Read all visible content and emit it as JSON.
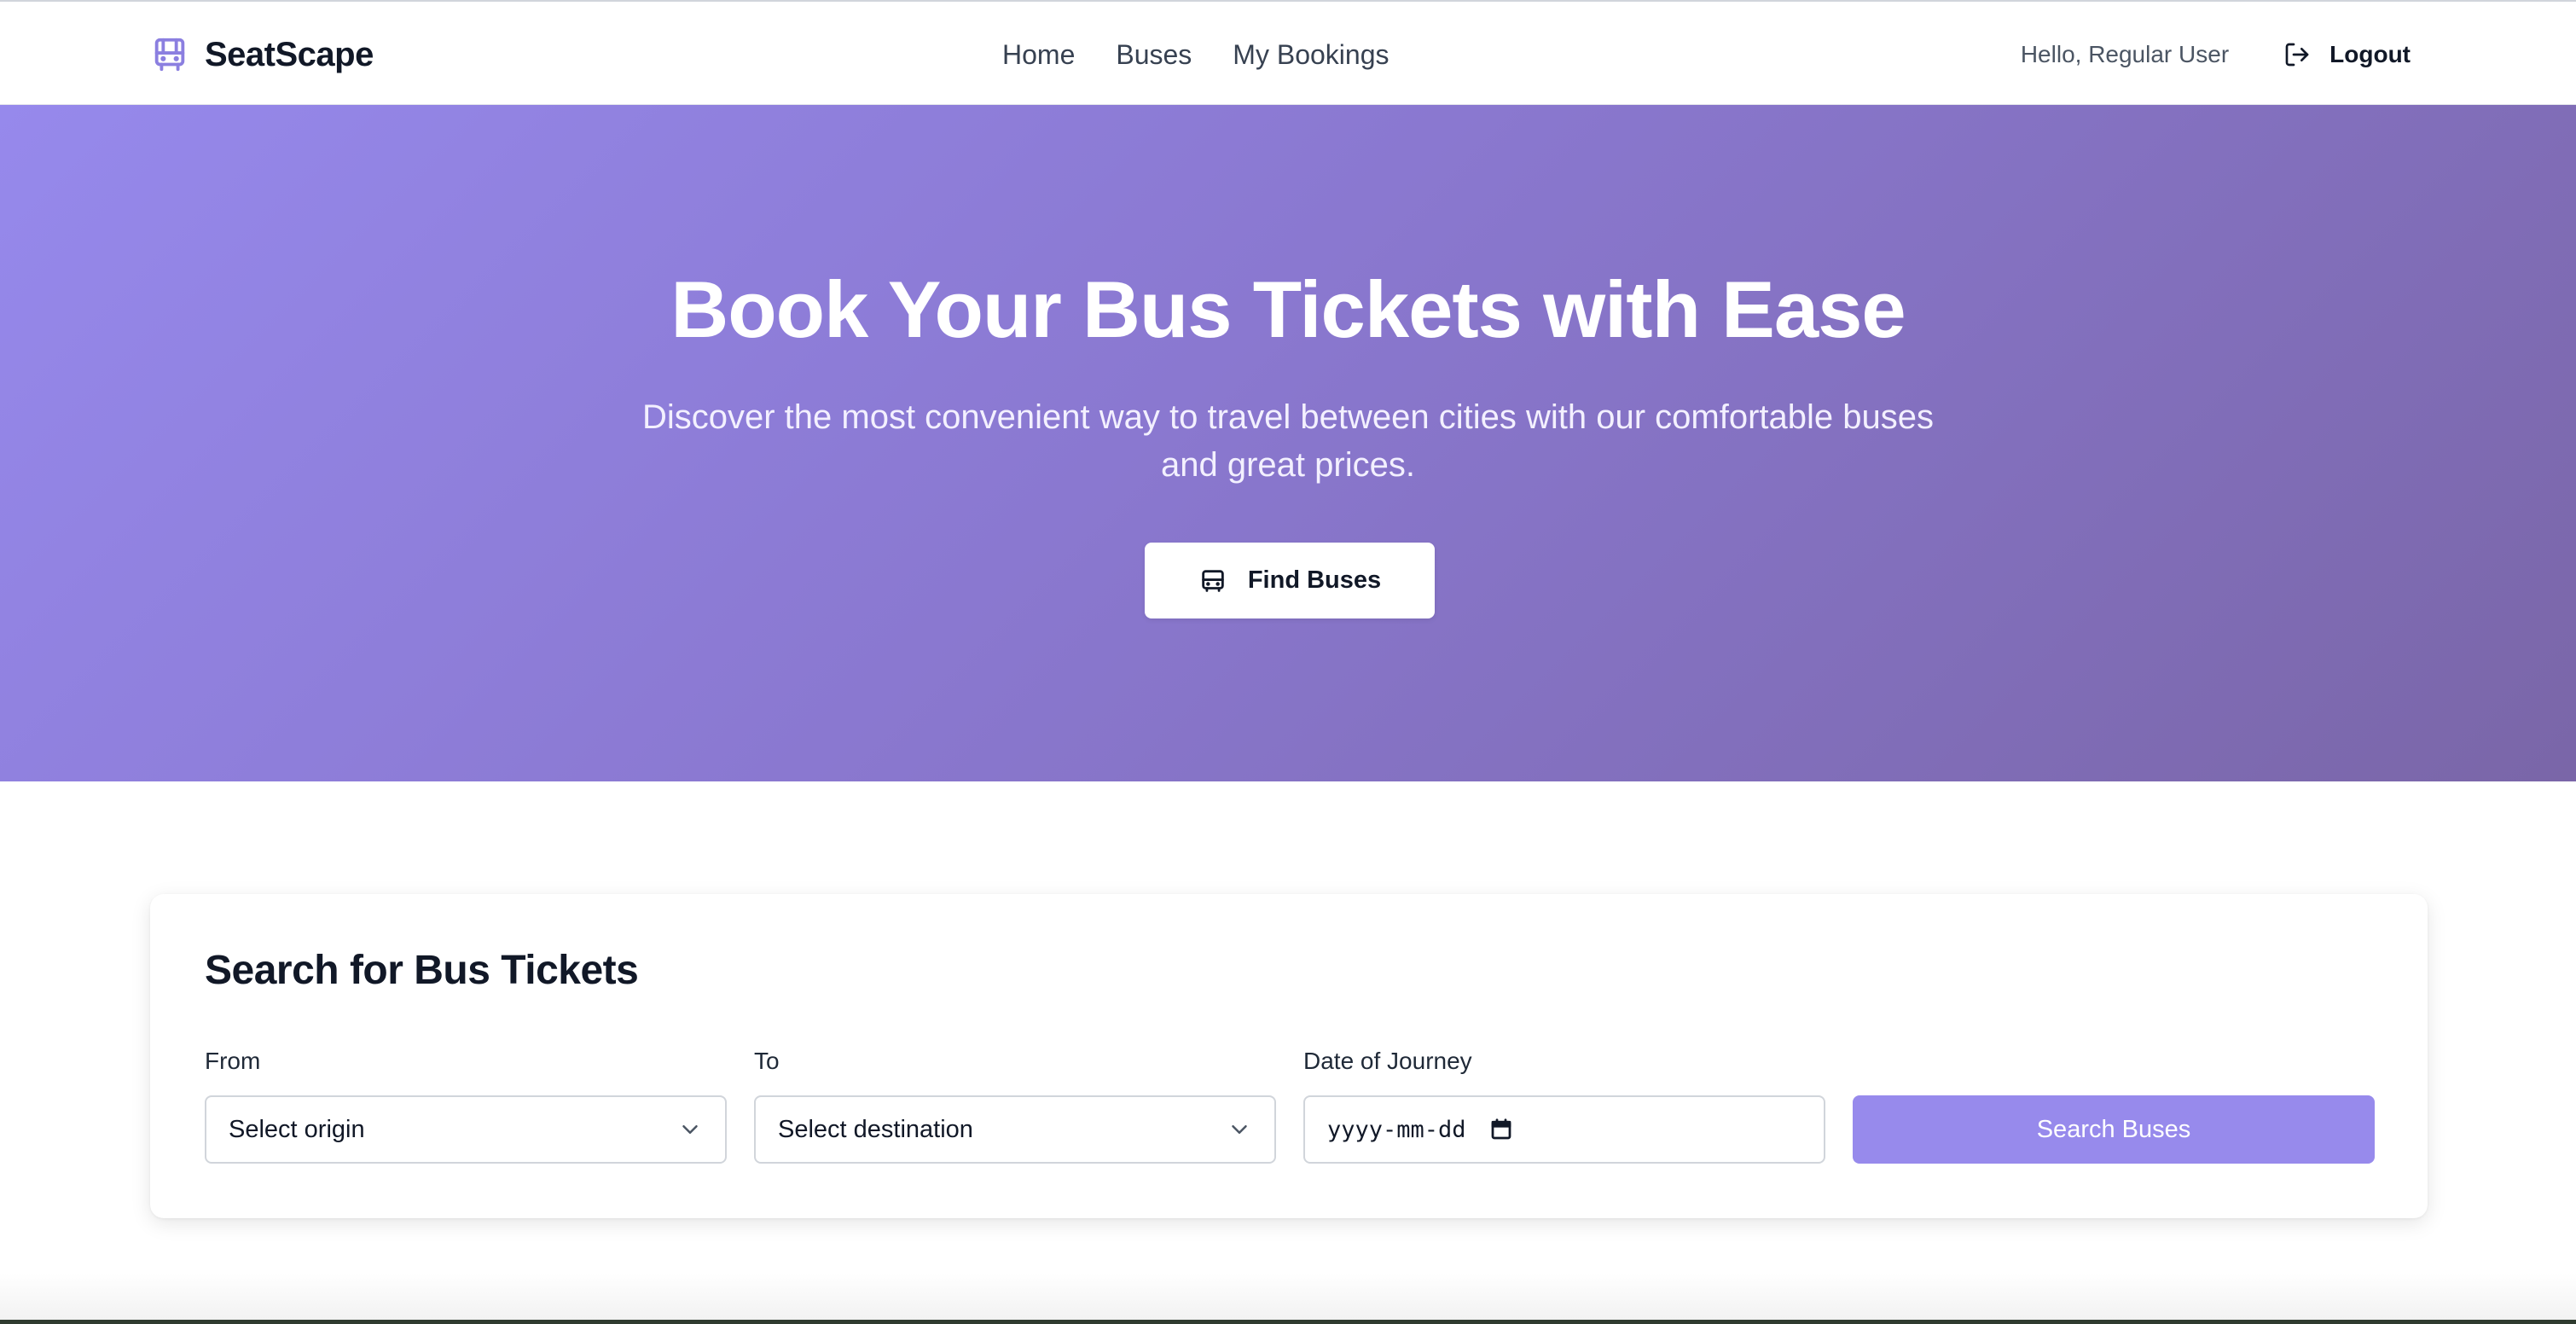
{
  "header": {
    "brand_name": "SeatScape",
    "brand_icon": "bus-icon",
    "nav": [
      {
        "label": "Home"
      },
      {
        "label": "Buses"
      },
      {
        "label": "My Bookings"
      }
    ],
    "greeting": "Hello, Regular User",
    "logout_label": "Logout",
    "logout_icon": "logout-icon"
  },
  "hero": {
    "title": "Book Your Bus Tickets with Ease",
    "subtitle": "Discover the most convenient way to travel between cities with our comfortable buses and great prices.",
    "cta_label": "Find Buses",
    "cta_icon": "bus-icon"
  },
  "search": {
    "title": "Search for Bus Tickets",
    "from_label": "From",
    "from_value": "Select origin",
    "to_label": "To",
    "to_value": "Select destination",
    "date_label": "Date of Journey",
    "date_value": "yyyy-mm-dd",
    "button_label": "Search Buses"
  },
  "colors": {
    "accent": "#978aec",
    "hero_start": "#9689ec",
    "hero_end": "#7a66a8",
    "brand_icon": "#8b7fe0"
  }
}
